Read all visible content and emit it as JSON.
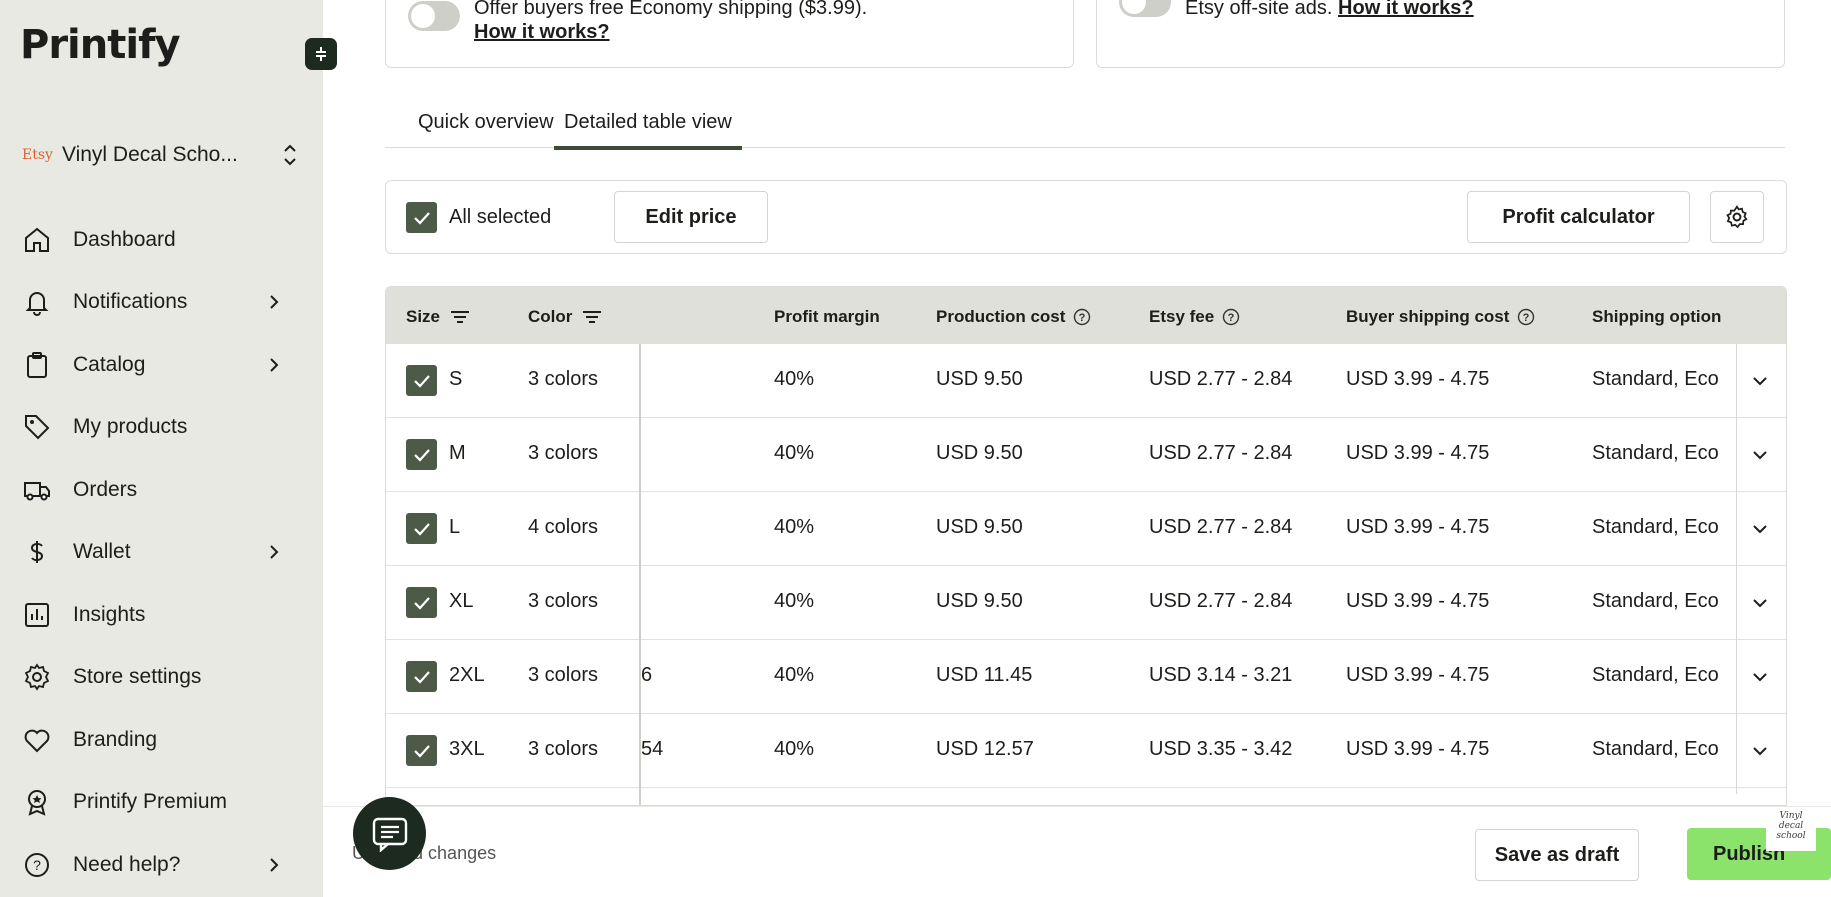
{
  "brand": {
    "logo_text": "Printify"
  },
  "store": {
    "platform": "Etsy",
    "name": "Vinyl Decal Scho..."
  },
  "nav": [
    {
      "label": "Dashboard",
      "icon": "home-icon",
      "has_chevron": false
    },
    {
      "label": "Notifications",
      "icon": "bell-icon",
      "has_chevron": true
    },
    {
      "label": "Catalog",
      "icon": "clipboard-icon",
      "has_chevron": true
    },
    {
      "label": "My products",
      "icon": "tag-icon",
      "has_chevron": false
    },
    {
      "label": "Orders",
      "icon": "truck-icon",
      "has_chevron": false
    },
    {
      "label": "Wallet",
      "icon": "dollar-icon",
      "has_chevron": true
    },
    {
      "label": "Insights",
      "icon": "bar-chart-icon",
      "has_chevron": false
    },
    {
      "label": "Store settings",
      "icon": "gear-icon",
      "has_chevron": false
    },
    {
      "label": "Branding",
      "icon": "heart-icon",
      "has_chevron": false
    },
    {
      "label": "Printify Premium",
      "icon": "premium-badge-icon",
      "has_chevron": false
    },
    {
      "label": "Need help?",
      "icon": "help-circle-icon",
      "has_chevron": true
    }
  ],
  "shipping_card": {
    "text": "Offer buyers free Economy shipping ($3.99).",
    "link": "How it works?",
    "toggle_on": false
  },
  "ads_card": {
    "text": "Etsy off-site ads.",
    "link": "How it works?",
    "toggle_on": false
  },
  "tabs": [
    {
      "label": "Quick overview",
      "active": false
    },
    {
      "label": "Detailed table view",
      "active": true
    }
  ],
  "toolbar": {
    "all_selected_label": "All selected",
    "edit_price_label": "Edit price",
    "profit_calculator_label": "Profit calculator"
  },
  "table": {
    "headers": {
      "size": "Size",
      "color": "Color",
      "profit_margin": "Profit margin",
      "production_cost": "Production cost",
      "etsy_fee": "Etsy fee",
      "buyer_shipping_cost": "Buyer shipping cost",
      "shipping_option": "Shipping option"
    },
    "rows": [
      {
        "size": "S",
        "colors": "3 colors",
        "partial": "",
        "margin": "40%",
        "production": "USD 9.50",
        "fee": "USD 2.77 - 2.84",
        "shipping_cost": "USD 3.99 - 4.75",
        "shipping_option": "Standard, Eco"
      },
      {
        "size": "M",
        "colors": "3 colors",
        "partial": "",
        "margin": "40%",
        "production": "USD 9.50",
        "fee": "USD 2.77 - 2.84",
        "shipping_cost": "USD 3.99 - 4.75",
        "shipping_option": "Standard, Eco"
      },
      {
        "size": "L",
        "colors": "4 colors",
        "partial": "",
        "margin": "40%",
        "production": "USD 9.50",
        "fee": "USD 2.77 - 2.84",
        "shipping_cost": "USD 3.99 - 4.75",
        "shipping_option": "Standard, Eco"
      },
      {
        "size": "XL",
        "colors": "3 colors",
        "partial": "",
        "margin": "40%",
        "production": "USD 9.50",
        "fee": "USD 2.77 - 2.84",
        "shipping_cost": "USD 3.99 - 4.75",
        "shipping_option": "Standard, Eco"
      },
      {
        "size": "2XL",
        "colors": "3 colors",
        "partial": "6",
        "margin": "40%",
        "production": "USD 11.45",
        "fee": "USD 3.14 - 3.21",
        "shipping_cost": "USD 3.99 - 4.75",
        "shipping_option": "Standard, Eco"
      },
      {
        "size": "3XL",
        "colors": "3 colors",
        "partial": "54",
        "margin": "40%",
        "production": "USD 12.57",
        "fee": "USD 3.35 - 3.42",
        "shipping_cost": "USD 3.99 - 4.75",
        "shipping_option": "Standard, Eco"
      }
    ]
  },
  "footer": {
    "unsaved_text": "Unsaved changes",
    "save_draft_label": "Save as draft",
    "publish_label": "Publish",
    "watermark": "Vinyl decal school"
  },
  "colors": {
    "sidebar_bg": "#e8e9e3",
    "accent_dark": "#1d2a1f",
    "checkbox": "#4e5a48",
    "publish_green": "#8be36b",
    "table_header_bg": "#dfe0d9"
  }
}
